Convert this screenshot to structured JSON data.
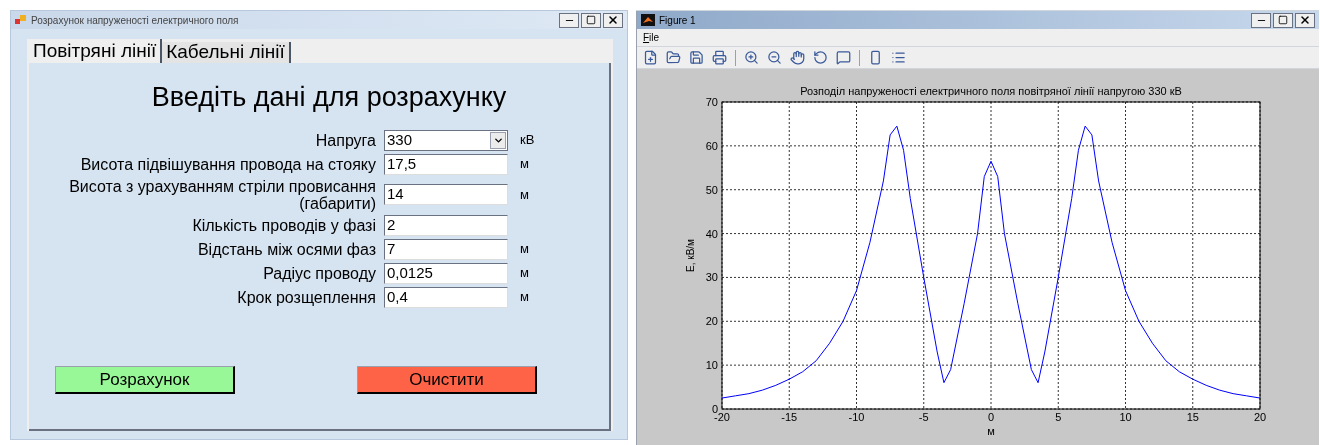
{
  "form_window": {
    "title": "Розрахунок напруженості електричного поля",
    "tabs": [
      {
        "label": "Повітряні лінії",
        "selected": true
      },
      {
        "label": "Кабельні лінії",
        "selected": false
      }
    ],
    "heading": "Введіть дані для розрахунку",
    "fields": [
      {
        "kind": "dropdown",
        "label": "Напруга",
        "value": "330",
        "unit": "кВ"
      },
      {
        "kind": "text",
        "label": "Висота підвішування провода на стояку",
        "value": "17,5",
        "unit": "м"
      },
      {
        "kind": "text",
        "label": "Висота з урахуванням стріли провисання (габарити)",
        "value": "14",
        "unit": "м"
      },
      {
        "kind": "text",
        "label": "Кількість проводів у фазі",
        "value": "2"
      },
      {
        "kind": "text",
        "label": "Відстань між осями фаз",
        "value": "7",
        "unit": "м"
      },
      {
        "kind": "text",
        "label": "Радіус проводу",
        "value": "0,0125",
        "unit": "м"
      },
      {
        "kind": "text",
        "label": "Крок розщеплення",
        "value": "0,4",
        "unit": "м"
      }
    ],
    "buttons": [
      {
        "kind": "calculate",
        "label": "Розрахунок"
      },
      {
        "kind": "clear",
        "label": "Очистити"
      }
    ]
  },
  "figure_window": {
    "title": "Figure 1",
    "menu": [
      "File"
    ],
    "chart_data": {
      "type": "line",
      "title": "Розподіл напруженості електричного поля повітряної лінії напругою 330 кВ",
      "xlabel": "м",
      "ylabel": "E, кВ/м",
      "x": [
        -20,
        -19,
        -18,
        -17,
        -16,
        -15,
        -14,
        -13,
        -12,
        -11,
        -10,
        -9,
        -8,
        -7.5,
        -7,
        -6.5,
        -6,
        -5,
        -4,
        -3.5,
        -3,
        -2,
        -1,
        -0.5,
        0,
        0.5,
        1,
        2,
        3,
        3.5,
        4,
        5,
        6,
        6.5,
        7,
        7.5,
        8,
        9,
        10,
        11,
        12,
        13,
        14,
        15,
        16,
        17,
        18,
        19,
        20
      ],
      "grid": true,
      "series": [
        {
          "color": "#0000ff",
          "values": [
            2.5,
            3,
            3.5,
            4.3,
            5.4,
            6.8,
            8.5,
            11,
            15,
            20,
            27,
            38,
            52,
            62.5,
            64.5,
            59,
            48,
            30,
            13,
            6,
            9,
            24,
            40,
            53,
            56.5,
            53,
            40,
            24,
            9,
            6,
            13,
            30,
            48,
            59,
            64.5,
            62.5,
            52,
            38,
            27,
            20,
            15,
            11,
            8.5,
            6.8,
            5.4,
            4.3,
            3.5,
            3,
            2.5
          ]
        }
      ],
      "xlim": [
        -20,
        20
      ],
      "ylim": [
        0,
        70
      ],
      "xticks": [
        -20,
        -15,
        -10,
        -5,
        0,
        5,
        10,
        15,
        20
      ],
      "yticks": [
        0,
        10,
        20,
        30,
        40,
        50,
        60,
        70
      ]
    }
  }
}
